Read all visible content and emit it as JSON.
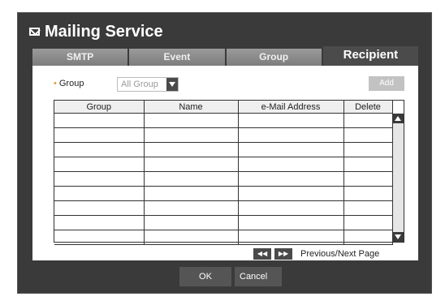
{
  "window": {
    "title": "Mailing Service"
  },
  "tabs": [
    {
      "label": "SMTP"
    },
    {
      "label": "Event"
    },
    {
      "label": "Group"
    },
    {
      "label": "Recipient"
    }
  ],
  "filter": {
    "label": "Group",
    "value": "All Group"
  },
  "add_label": "Add",
  "table": {
    "headers": [
      "Group",
      "Name",
      "e-Mail Address",
      "Delete"
    ]
  },
  "pager": {
    "prev": "◀◀",
    "next": "▶▶",
    "label": "Previous/Next Page"
  },
  "footer": {
    "ok": "OK",
    "cancel": "Cancel"
  }
}
